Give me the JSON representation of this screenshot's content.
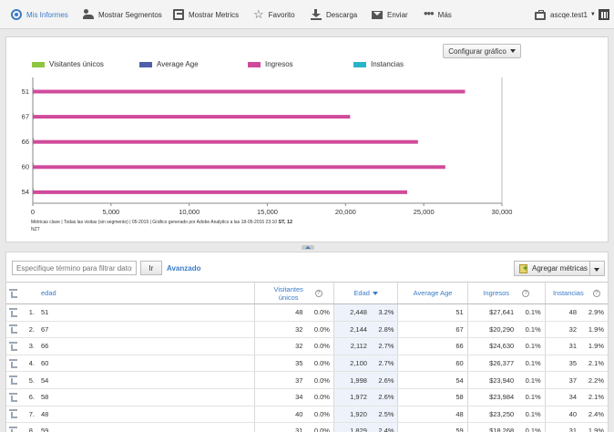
{
  "toolbar": {
    "items": [
      {
        "label": "Mis Informes",
        "icon": "target-icon"
      },
      {
        "label": "Mostrar Segmentos",
        "icon": "people-icon"
      },
      {
        "label": "Mostrar Metrics",
        "icon": "calculator-icon"
      },
      {
        "label": "Favorito",
        "icon": "star-icon"
      },
      {
        "label": "Descarga",
        "icon": "download-icon"
      },
      {
        "label": "Enviar",
        "icon": "mail-icon"
      },
      {
        "label": "Más",
        "icon": "more-icon"
      }
    ],
    "suite": "ascqe.test1",
    "calendar_icon": "calendar-icon",
    "active_color": "#3a7bc8"
  },
  "chart": {
    "config_button": "Configurar gráfico",
    "footnote_main": "Métricas clave  | Todas las visitas (sin segmento) | 05-2015 | Gráfico generado por Adobe Analytics a las 18-05-2015 23:10",
    "footnote_tz": "ST, 12",
    "footnote_tz2": "NZT"
  },
  "chart_data": {
    "type": "bar",
    "orientation": "horizontal",
    "categories": [
      "51",
      "67",
      "66",
      "60",
      "54"
    ],
    "series": [
      {
        "name": "Visitantes únicos",
        "color": "#8dc63f",
        "values": [
          48,
          32,
          32,
          35,
          37
        ]
      },
      {
        "name": "Average Age",
        "color": "#4f5fa8",
        "values": [
          51,
          67,
          66,
          60,
          54
        ]
      },
      {
        "name": "Ingresos",
        "color": "#d04a9b",
        "values": [
          27641,
          20290,
          24630,
          26377,
          23940
        ]
      },
      {
        "name": "Instancias",
        "color": "#28b4c8",
        "values": [
          48,
          32,
          31,
          35,
          37
        ]
      }
    ],
    "xlim": [
      0,
      30000
    ],
    "xticks": [
      "0",
      "5,000",
      "10,000",
      "15,000",
      "20,000",
      "25,000",
      "30,000"
    ],
    "xtick_values": [
      0,
      5000,
      10000,
      15000,
      20000,
      25000,
      30000
    ],
    "legend": "top",
    "grid": false
  },
  "table_controls": {
    "filter_placeholder": "Especifique término para filtrar datos",
    "go": "Ir",
    "advanced": "Avanzado",
    "add_metrics": "Agregar métricas"
  },
  "table": {
    "columns": {
      "dimension": "edad",
      "unique_visitors": "Visitantes únicos",
      "age": "Edad",
      "average_age": "Average Age",
      "revenue": "Ingresos",
      "instances": "Instancias"
    },
    "rows": [
      {
        "rank": "1.",
        "dim": "51",
        "uv": "48",
        "uv_pct": "0.0%",
        "age": "2,448",
        "age_pct": "3.2%",
        "avg": "51",
        "rev": "$27,641",
        "rev_pct": "0.1%",
        "inst": "48",
        "inst_pct": "2.9%"
      },
      {
        "rank": "2.",
        "dim": "67",
        "uv": "32",
        "uv_pct": "0.0%",
        "age": "2,144",
        "age_pct": "2.8%",
        "avg": "67",
        "rev": "$20,290",
        "rev_pct": "0.1%",
        "inst": "32",
        "inst_pct": "1.9%"
      },
      {
        "rank": "3.",
        "dim": "66",
        "uv": "32",
        "uv_pct": "0.0%",
        "age": "2,112",
        "age_pct": "2.7%",
        "avg": "66",
        "rev": "$24,630",
        "rev_pct": "0.1%",
        "inst": "31",
        "inst_pct": "1.9%"
      },
      {
        "rank": "4.",
        "dim": "60",
        "uv": "35",
        "uv_pct": "0.0%",
        "age": "2,100",
        "age_pct": "2.7%",
        "avg": "60",
        "rev": "$26,377",
        "rev_pct": "0.1%",
        "inst": "35",
        "inst_pct": "2.1%"
      },
      {
        "rank": "5.",
        "dim": "54",
        "uv": "37",
        "uv_pct": "0.0%",
        "age": "1,998",
        "age_pct": "2.6%",
        "avg": "54",
        "rev": "$23,940",
        "rev_pct": "0.1%",
        "inst": "37",
        "inst_pct": "2.2%"
      },
      {
        "rank": "6.",
        "dim": "58",
        "uv": "34",
        "uv_pct": "0.0%",
        "age": "1,972",
        "age_pct": "2.6%",
        "avg": "58",
        "rev": "$23,984",
        "rev_pct": "0.1%",
        "inst": "34",
        "inst_pct": "2.1%"
      },
      {
        "rank": "7.",
        "dim": "48",
        "uv": "40",
        "uv_pct": "0.0%",
        "age": "1,920",
        "age_pct": "2.5%",
        "avg": "48",
        "rev": "$23,250",
        "rev_pct": "0.1%",
        "inst": "40",
        "inst_pct": "2.4%"
      },
      {
        "rank": "8.",
        "dim": "59",
        "uv": "31",
        "uv_pct": "0.0%",
        "age": "1,829",
        "age_pct": "2.4%",
        "avg": "59",
        "rev": "$18,268",
        "rev_pct": "0.1%",
        "inst": "31",
        "inst_pct": "1.9%"
      }
    ]
  }
}
